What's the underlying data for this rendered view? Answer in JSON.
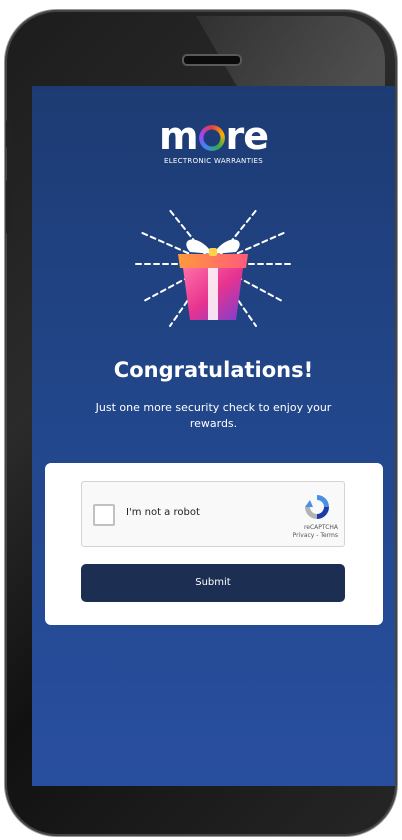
{
  "logo": {
    "wordmark_start": "m",
    "wordmark_end": "re",
    "tagline": "ELECTRONIC WARRANTIES"
  },
  "congrats": {
    "title": "Congratulations!",
    "subtitle": "Just one more security check to enjoy your rewards."
  },
  "captcha": {
    "label": "I'm not a robot",
    "brand": "reCAPTCHA",
    "links": "Privacy - Terms"
  },
  "form": {
    "submit_label": "Submit"
  },
  "colors": {
    "screen_bg": "#22468a",
    "button_bg": "#1c2f52",
    "gift_box": "#e8338f"
  }
}
